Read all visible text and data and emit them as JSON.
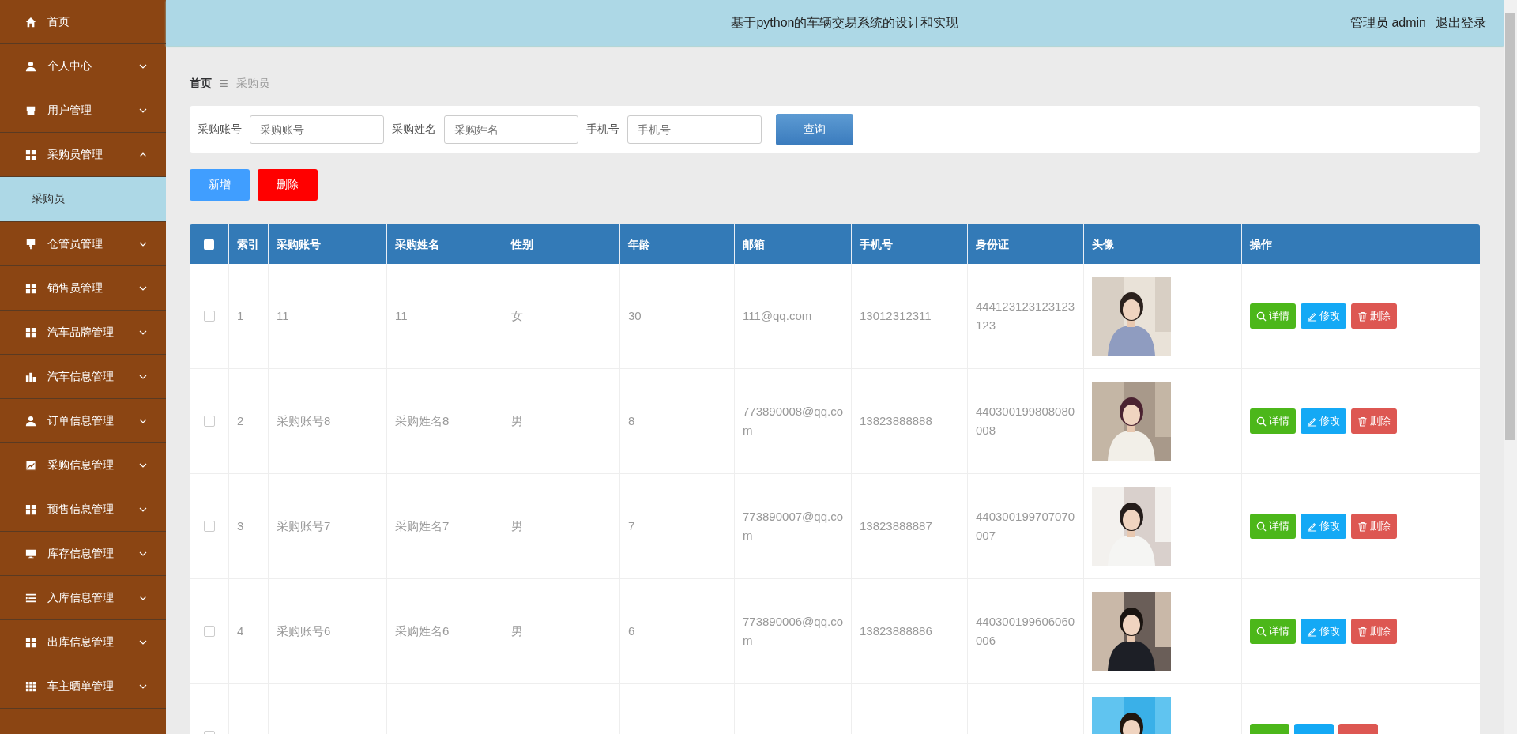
{
  "sidebar": {
    "items": [
      {
        "kind": "link",
        "label": "首页"
      },
      {
        "kind": "menu",
        "label": "个人中心",
        "expanded": false
      },
      {
        "kind": "menu",
        "label": "用户管理",
        "expanded": false
      },
      {
        "kind": "menu",
        "label": "采购员管理",
        "expanded": true,
        "children": [
          {
            "label": "采购员",
            "selected": true
          }
        ]
      },
      {
        "kind": "menu",
        "label": "仓管员管理",
        "expanded": false
      },
      {
        "kind": "menu",
        "label": "销售员管理",
        "expanded": false
      },
      {
        "kind": "menu",
        "label": "汽车品牌管理",
        "expanded": false
      },
      {
        "kind": "menu",
        "label": "汽车信息管理",
        "expanded": false
      },
      {
        "kind": "menu",
        "label": "订单信息管理",
        "expanded": false
      },
      {
        "kind": "menu",
        "label": "采购信息管理",
        "expanded": false
      },
      {
        "kind": "menu",
        "label": "预售信息管理",
        "expanded": false
      },
      {
        "kind": "menu",
        "label": "库存信息管理",
        "expanded": false
      },
      {
        "kind": "menu",
        "label": "入库信息管理",
        "expanded": false
      },
      {
        "kind": "menu",
        "label": "出库信息管理",
        "expanded": false
      },
      {
        "kind": "menu",
        "label": "车主晒单管理",
        "expanded": false
      }
    ]
  },
  "header": {
    "title": "基于python的车辆交易系统的设计和实现",
    "user": "管理员 admin",
    "logout": "退出登录"
  },
  "breadcrumb": {
    "home": "首页",
    "separator": "☰",
    "current": "采购员"
  },
  "search": {
    "fields": [
      {
        "label": "采购账号",
        "placeholder": "采购账号"
      },
      {
        "label": "采购姓名",
        "placeholder": "采购姓名"
      },
      {
        "label": "手机号",
        "placeholder": "手机号"
      }
    ],
    "button": "查询"
  },
  "actions": {
    "add": "新增",
    "delete": "删除"
  },
  "table": {
    "select_all_checked": false,
    "columns": [
      "索引",
      "采购账号",
      "采购姓名",
      "性别",
      "年龄",
      "邮箱",
      "手机号",
      "身份证",
      "头像",
      "操作"
    ],
    "rows": [
      {
        "checked": false,
        "index": "1",
        "account": "11",
        "name": "11",
        "gender": "女",
        "age": "30",
        "email": "111@qq.com",
        "phone": "13012312311",
        "id_card": "444123123123123123",
        "buttons": {
          "detail": "详情",
          "edit": "修改",
          "delete": "删除"
        }
      },
      {
        "checked": false,
        "index": "2",
        "account": "采购账号8",
        "name": "采购姓名8",
        "gender": "男",
        "age": "8",
        "email": "773890008@qq.com",
        "phone": "13823888888",
        "id_card": "440300199808080008",
        "buttons": {
          "detail": "详情",
          "edit": "修改",
          "delete": "删除"
        }
      },
      {
        "checked": false,
        "index": "3",
        "account": "采购账号7",
        "name": "采购姓名7",
        "gender": "男",
        "age": "7",
        "email": "773890007@qq.com",
        "phone": "13823888887",
        "id_card": "440300199707070007",
        "buttons": {
          "detail": "详情",
          "edit": "修改",
          "delete": "删除"
        }
      },
      {
        "checked": false,
        "index": "4",
        "account": "采购账号6",
        "name": "采购姓名6",
        "gender": "男",
        "age": "6",
        "email": "773890006@qq.com",
        "phone": "13823888886",
        "id_card": "440300199606060006",
        "buttons": {
          "detail": "详情",
          "edit": "修改",
          "delete": "删除"
        }
      },
      {
        "checked": false
      }
    ]
  }
}
